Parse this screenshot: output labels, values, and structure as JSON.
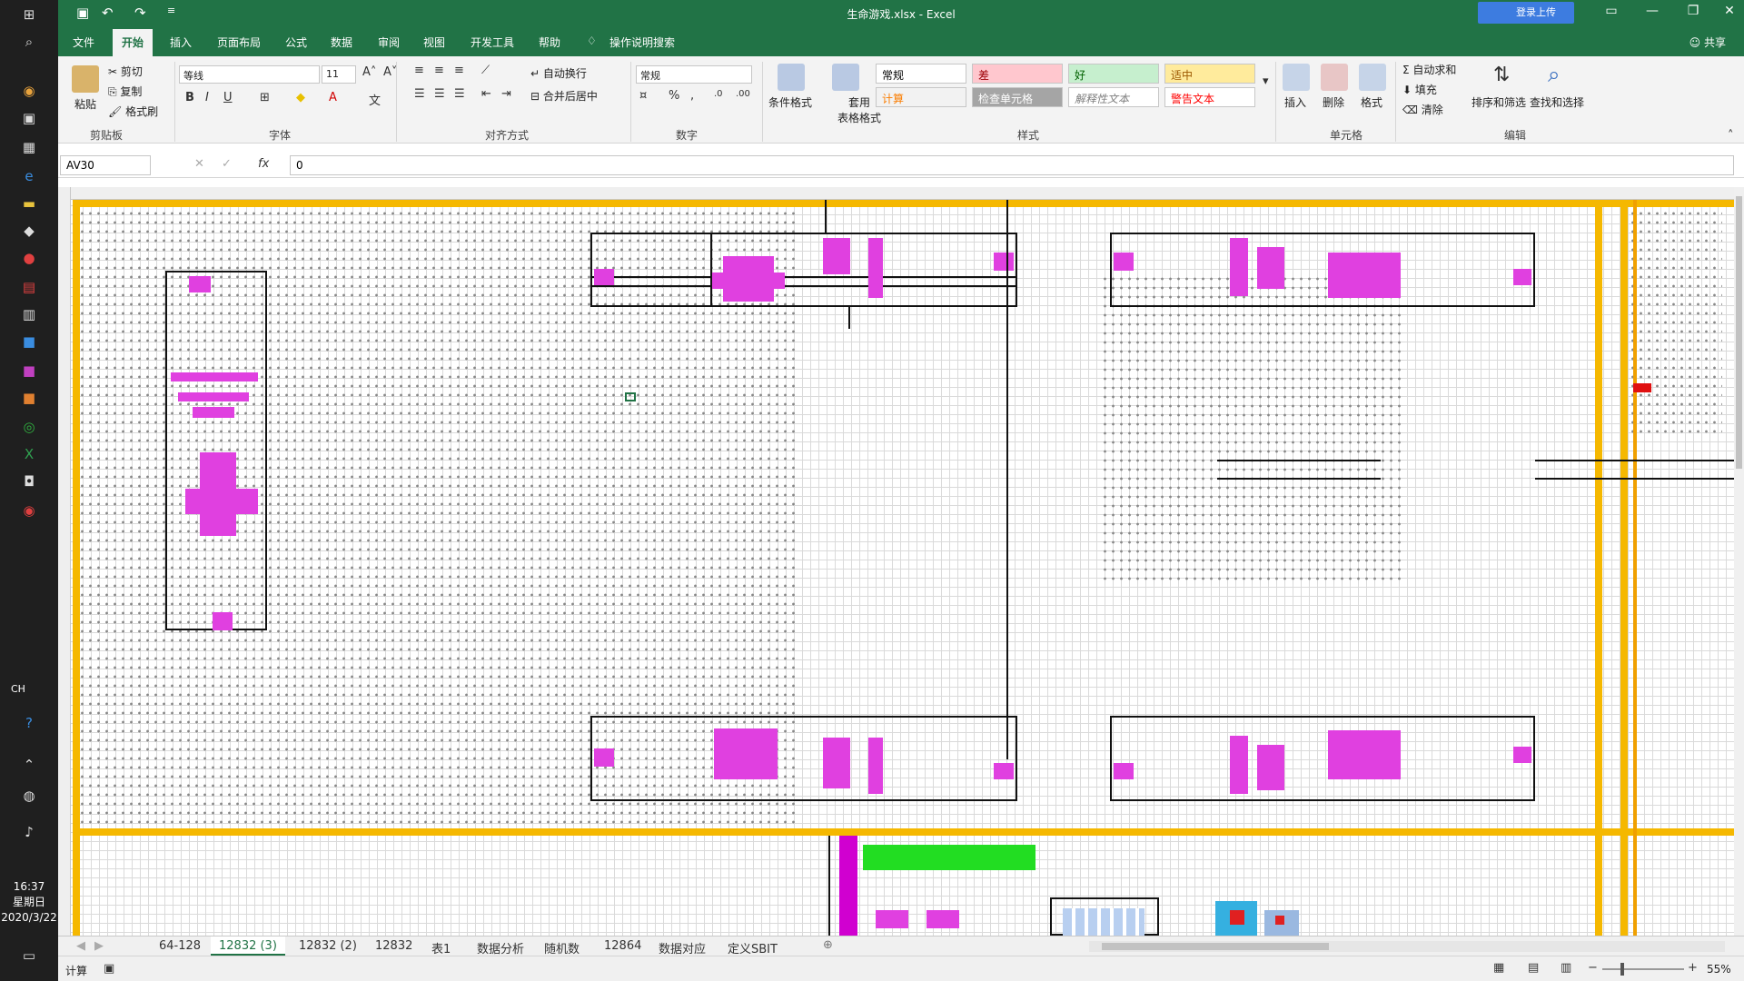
{
  "window": {
    "title": "生命游戏.xlsx  -  Excel",
    "upload_label": "登录上传"
  },
  "ribbon_tabs": [
    "文件",
    "开始",
    "插入",
    "页面布局",
    "公式",
    "数据",
    "审阅",
    "视图",
    "开发工具",
    "帮助"
  ],
  "search_hint": "操作说明搜索",
  "share_label": "共享",
  "clipboard": {
    "paste": "粘贴",
    "cut": "剪切",
    "copy": "复制",
    "format_painter": "格式刷",
    "group": "剪贴板"
  },
  "font": {
    "name": "等线",
    "size": "11",
    "group": "字体"
  },
  "alignment": {
    "wrap": "自动换行",
    "merge": "合并后居中",
    "group": "对齐方式"
  },
  "number": {
    "format": "常规",
    "group": "数字"
  },
  "styles": {
    "conditional": "条件格式",
    "table_format": "套用\n表格格式",
    "normal": "常规",
    "bad": "差",
    "good": "好",
    "neutral": "适中",
    "calculation": "计算",
    "check_cell": "检查单元格",
    "explanatory": "解释性文本",
    "warning": "警告文本",
    "group": "样式"
  },
  "cells": {
    "insert": "插入",
    "delete": "删除",
    "format": "格式",
    "group": "单元格"
  },
  "editing": {
    "autosum": "自动求和",
    "fill": "填充",
    "clear": "清除",
    "sort": "排序和筛选",
    "find": "查找和选择",
    "group": "编辑"
  },
  "formula_bar": {
    "name_box": "AV30",
    "fx": "fx",
    "value": "0"
  },
  "sheet_tabs": [
    "64-128",
    "12832 (3)",
    "12832 (2)",
    "12832",
    "表1",
    "数据分析",
    "随机数",
    "12864",
    "数据对应",
    "定义SBIT"
  ],
  "active_sheet_index": 1,
  "status": {
    "mode": "计算",
    "zoom": "55%"
  },
  "clock": {
    "time": "16:37",
    "weekday": "星期日",
    "date": "2020/3/22"
  },
  "lang": "CH"
}
